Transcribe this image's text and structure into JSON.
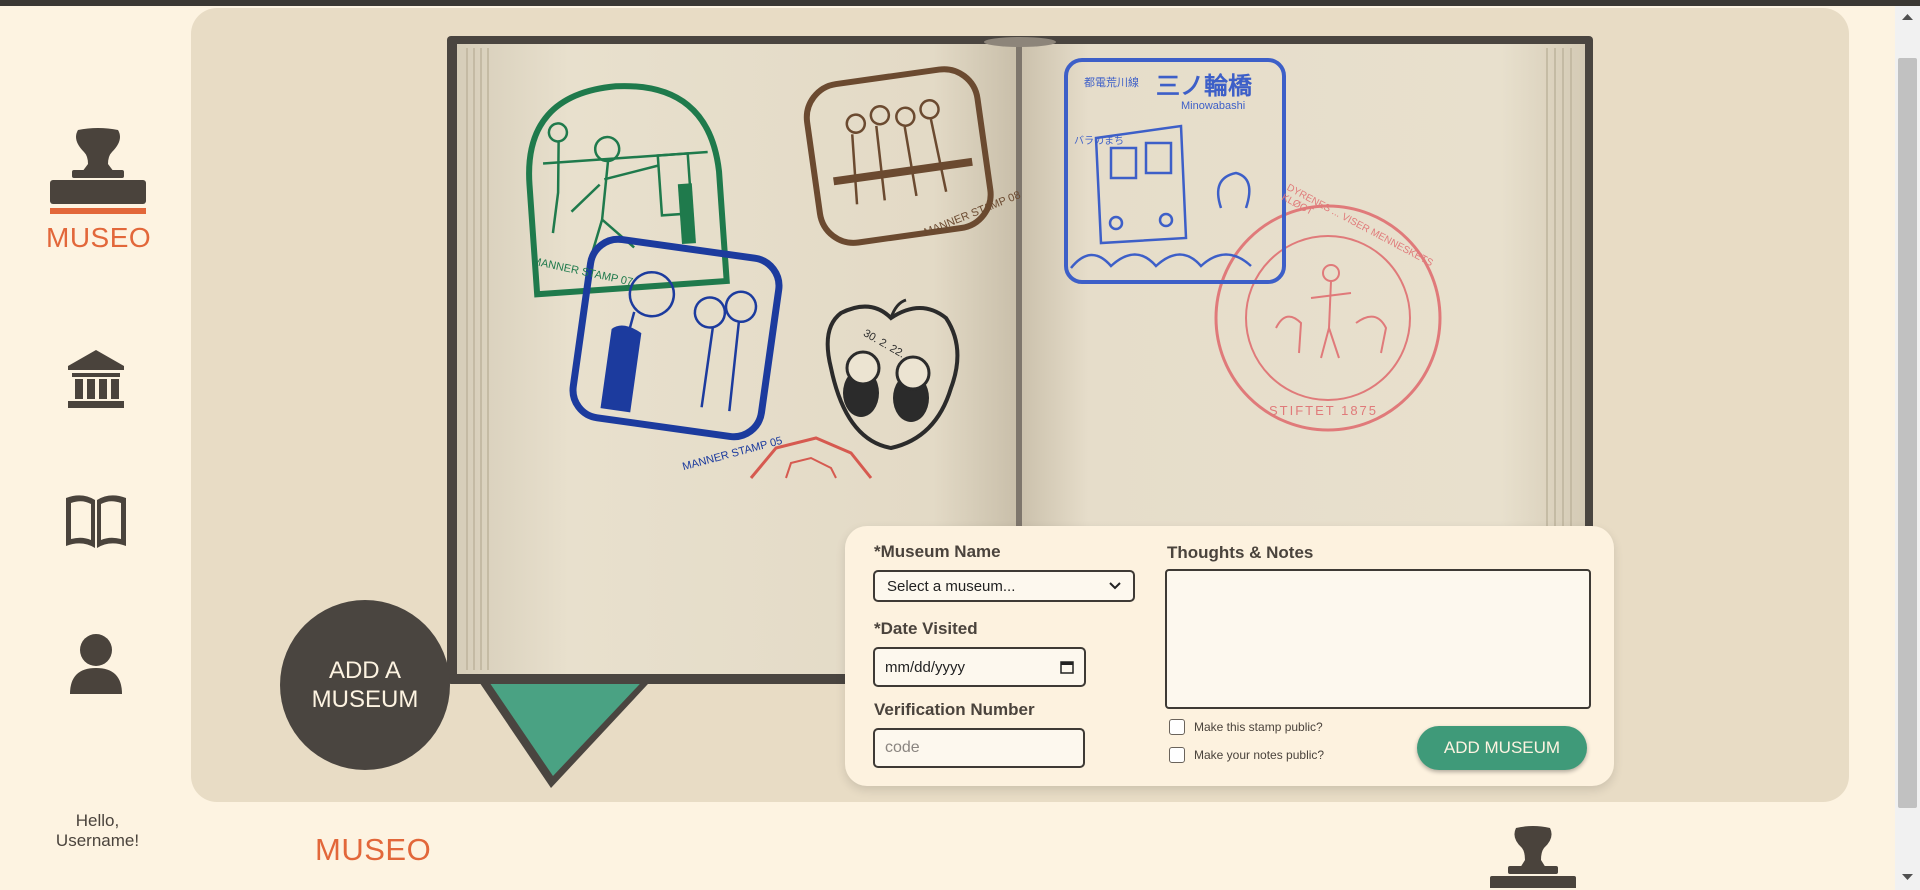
{
  "app": {
    "logo_text": "MUSEO"
  },
  "sidebar": {
    "nav": [
      {
        "name": "museums",
        "icon": "museum-building-icon"
      },
      {
        "name": "passport",
        "icon": "open-book-icon"
      },
      {
        "name": "profile",
        "icon": "user-icon"
      }
    ],
    "greeting_line1": "Hello,",
    "greeting_line2": "Username!"
  },
  "hero": {
    "add_circle_line1": "ADD A",
    "add_circle_line2": "MUSEUM",
    "stamp_texts": {
      "green": "MANNER STAMP 07",
      "brown": "MANNER STAMP 08",
      "blue": "MANNER STAMP 05",
      "cat_date": "30. 2. 22.",
      "jp_line": "都電荒川線",
      "jp_station": "三ノ輪橋",
      "jp_romaji": "Minowabashi",
      "jp_small": "バラのまち",
      "red_circle": "DYRENES ... VISER MENNESKETS KLØGT",
      "red_year": "STIFTET 1875"
    }
  },
  "form": {
    "museum_label": "*Museum Name",
    "museum_value": "Select a museum...",
    "date_label": "*Date Visited",
    "date_value": "mm/dd/yyyy",
    "verification_label": "Verification Number",
    "verification_placeholder": "code",
    "notes_label": "Thoughts & Notes",
    "public_stamp_label": "Make this stamp public?",
    "public_notes_label": "Make your notes public?",
    "submit_label": "ADD MUSEUM"
  },
  "footer": {
    "logo_text": "MUSEO"
  },
  "colors": {
    "accent": "#e2673a",
    "primary_dark": "#4a4540",
    "green": "#3f9a79",
    "background": "#fdf3e1",
    "panel": "#e8dcc5"
  }
}
